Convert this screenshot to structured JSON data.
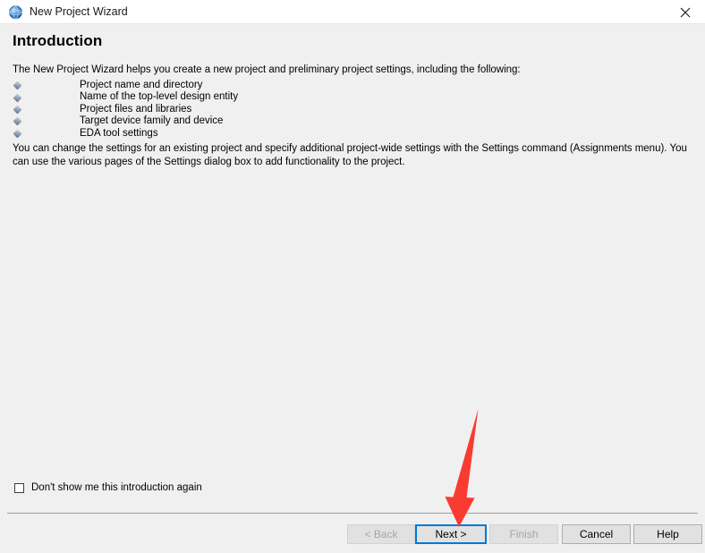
{
  "window": {
    "title": "New Project Wizard",
    "app_icon": "quartus-globe-icon",
    "close_icon": "close-icon"
  },
  "page": {
    "heading": "Introduction",
    "intro_paragraph": "The New Project Wizard helps you create a new project and preliminary project settings, including the following:",
    "feature_items": [
      "Project name and directory",
      "Name of the top-level design entity",
      "Project files and libraries",
      "Target device family and device",
      "EDA tool settings"
    ],
    "settings_paragraph": "You can change the settings for an existing project and specify additional project-wide settings with the Settings command (Assignments menu). You can use the various pages of the Settings dialog box to add functionality to the project."
  },
  "options": {
    "dont_show_label": "Don't show me this introduction again",
    "dont_show_checked": false
  },
  "footer": {
    "back_label": "< Back",
    "next_label": "Next >",
    "finish_label": "Finish",
    "cancel_label": "Cancel",
    "help_label": "Help"
  },
  "annotation": {
    "arrow_color": "#f93b32",
    "arrow_target": "Next >"
  },
  "colors": {
    "titlebar_background": "#ffffff",
    "content_background": "#f0f0f0",
    "button_face": "#e1e1e1",
    "button_border": "#adadad",
    "focus_border": "#0078d7",
    "disabled_text": "#a6a6a6",
    "separator": "#a0a0a0",
    "bullet": "#5c6f8e"
  }
}
